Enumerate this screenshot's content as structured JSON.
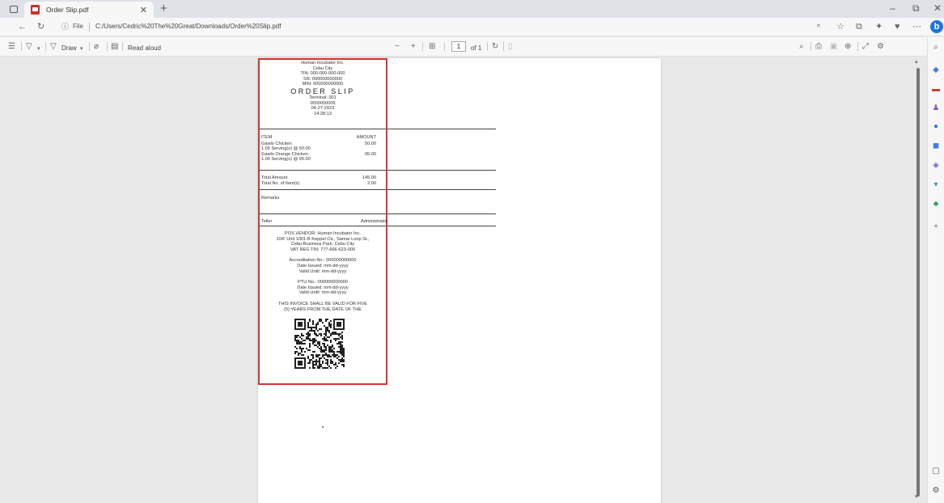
{
  "browser": {
    "tab_title": "Order Slip.pdf",
    "address_scheme": "File",
    "address_url": "C:/Users/Cedric%20The%20Great/Downloads/Order%20Slip.pdf"
  },
  "pdf_toolbar": {
    "draw_label": "Draw",
    "read_aloud_label": "Read aloud",
    "page_current": "1",
    "page_total": "of 1"
  },
  "receipt": {
    "company": "Human Incubator Inc.",
    "city": "Cebu City",
    "tin": "TIN: 000-000-000-000",
    "sn": "SN: 000000000000",
    "min": "MIN: 000000000000",
    "title": "ORDER SLIP",
    "terminal": "Terminal: 001",
    "slip_number": "0000000009",
    "date": "04-27-2023",
    "time": "14:28:13",
    "col_item": "ITEM",
    "col_amount": "AMOUNT",
    "items": [
      {
        "name": "Gawlo Chicken",
        "detail": "1.00 Serving(s) @ 50.00",
        "amount": "50.00"
      },
      {
        "name": "Gawlo Orange Chicken",
        "detail": "1.00 Serving(s) @ 95.00",
        "amount": "95.00"
      }
    ],
    "total_amount_label": "Total Amount",
    "total_amount": "145.00",
    "total_items_label": "Total No. of Item(s)",
    "total_items": "2.00",
    "remarks_label": "Remarks",
    "teller_label": "Teller",
    "teller_value": "Administrator",
    "vendor_line1": "POS VENDOR: Human Incubator Inc.",
    "vendor_line2": "10/F Unit 1001-B Keppel Ctr., Samar Loop St.,",
    "vendor_line3": "Cebu Business Park, Cebu City",
    "vendor_line4": "VAT REG TIN: 777-666-623-000",
    "accreditation": "Accreditation No.: 000000000000",
    "accreditation_issued": "Date Issued: mm-dd-yyyy",
    "accreditation_valid": "Valid Until: mm-dd-yyyy",
    "ptu": "PTU No.: 000000000000",
    "ptu_issued": "Date Issued: mm-dd-yyyy",
    "ptu_valid": "Valid Until: mm-dd-yyyy",
    "invoice_note1": "THIS INVOICE SHALL BE VALID FOR FIVE",
    "invoice_note2": "(5) YEARS FROM THE DATE OF THE"
  },
  "colors": {
    "highlight_border": "#d2372f",
    "bing_blue": "#1b75e0",
    "pdf_icon_red": "#c8322c"
  },
  "icons": {
    "sidebar": [
      "search-icon",
      "copilot-diamond-icon",
      "shopping-bag-icon",
      "people-icon",
      "circle-app-icon",
      "office-icon",
      "outlook-icon",
      "drop-icon",
      "tree-icon",
      "add-icon"
    ]
  }
}
